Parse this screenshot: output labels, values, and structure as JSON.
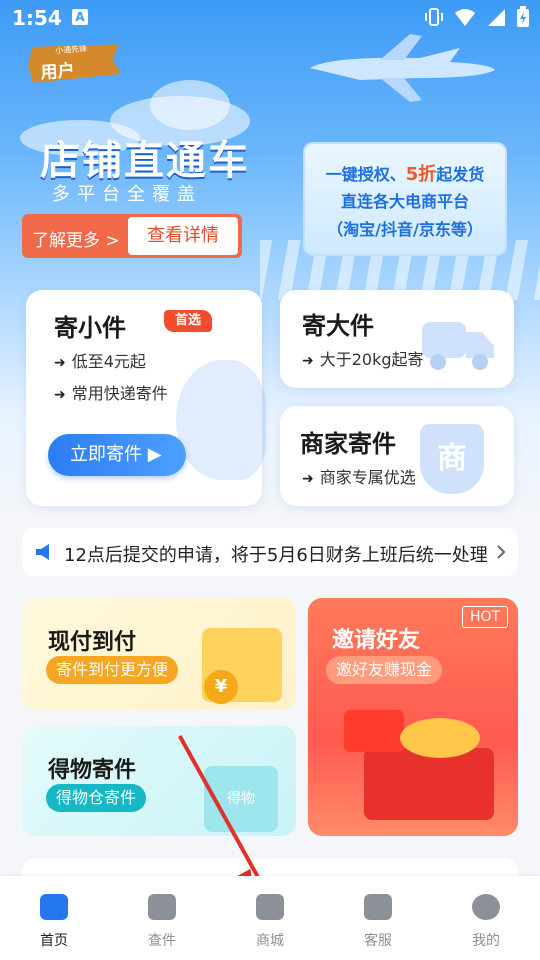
{
  "status_bar": {
    "time": "1:54",
    "a_icon": "A"
  },
  "user_badge": {
    "small": "小通先锋",
    "big": "用户"
  },
  "hero": {
    "title": "店铺直通车",
    "subtitle": "多平台全覆盖",
    "learn_more": "了解更多 >",
    "view_details": "查看详情",
    "promo": {
      "line1_pre": "一键授权、",
      "line1_hl": "5折",
      "line1_post": "起发货",
      "line2": "直连各大电商平台",
      "line3": "（淘宝/抖音/京东等）"
    }
  },
  "cards": {
    "small": {
      "title": "寄小件",
      "tag": "首选",
      "line1": "低至4元起",
      "line2": "常用快递寄件",
      "button": "立即寄件 ▶"
    },
    "big": {
      "title": "寄大件",
      "line1": "大于20kg起寄"
    },
    "merchant": {
      "title": "商家寄件",
      "line1": "商家专属优选",
      "icon_text": "商"
    }
  },
  "notice": {
    "text": "12点后提交的申请，将于5月6日财务上班后统一处理"
  },
  "tiles": {
    "cod": {
      "title": "现付到付",
      "pill": "寄件到付更方便",
      "icon_text": "¥"
    },
    "dewu": {
      "title": "得物寄件",
      "pill": "得物仓寄件",
      "box_text": "得物"
    },
    "invite": {
      "title": "邀请好友",
      "pill": "邀好友赚现金",
      "hot": "HOT"
    }
  },
  "tabbar": [
    {
      "label": "首页",
      "icon": "home-icon"
    },
    {
      "label": "查件",
      "icon": "track-icon"
    },
    {
      "label": "商城",
      "icon": "shop-icon"
    },
    {
      "label": "客服",
      "icon": "chat-icon"
    },
    {
      "label": "我的",
      "icon": "profile-icon"
    }
  ],
  "colors": {
    "primary": "#2577f0",
    "accent_red": "#f24c2c",
    "annotation_arrow": "#e0322a"
  }
}
